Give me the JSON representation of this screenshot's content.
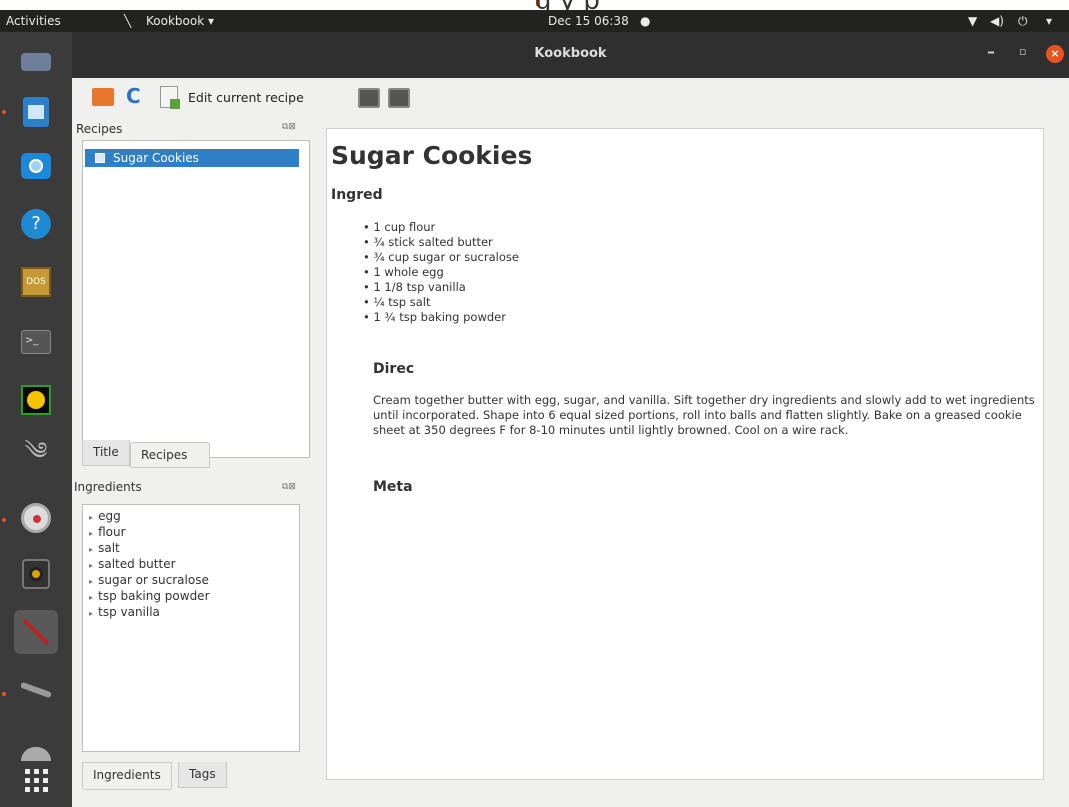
{
  "topbar": {
    "activities": "Activities",
    "app_menu": "Kookbook ▾",
    "datetime": "Dec 15  06:38",
    "cutoff_text": "g      y p"
  },
  "window": {
    "title": "Kookbook"
  },
  "toolbar": {
    "edit_label": "Edit current recipe"
  },
  "recipes_panel": {
    "title": "Recipes",
    "items": [
      "Sugar Cookies"
    ],
    "tabs": [
      "Title",
      "Recipes"
    ]
  },
  "ingredients_panel": {
    "title": "Ingredients",
    "items": [
      "egg",
      "flour",
      "salt",
      "salted butter",
      "sugar or sucralose",
      "tsp baking powder",
      "tsp vanilla"
    ],
    "tabs": [
      "Ingredients",
      "Tags"
    ]
  },
  "recipe": {
    "title": "Sugar Cookies",
    "ingredients_heading": "Ingred",
    "ingredients": [
      "1 cup flour",
      "¾ stick salted butter",
      "¾ cup sugar or sucralose",
      "1 whole egg",
      "1 1/8 tsp vanilla",
      "¼ tsp salt",
      "1 ¾ tsp baking powder"
    ],
    "directions_heading": "Direc",
    "directions": "Cream together butter with egg, sugar, and vanilla. Sift together dry ingredients and slowly add to wet ingredients until incorporated. Shape into 6 equal sized portions, roll into balls and flatten slightly. Bake on a greased cookie sheet at 350 degrees F for 8-10 minutes until lightly browned. Cool on a wire rack.",
    "meta_heading": "Meta"
  },
  "icons": {
    "accent": "#e95420",
    "selection": "#2f7fc6"
  }
}
